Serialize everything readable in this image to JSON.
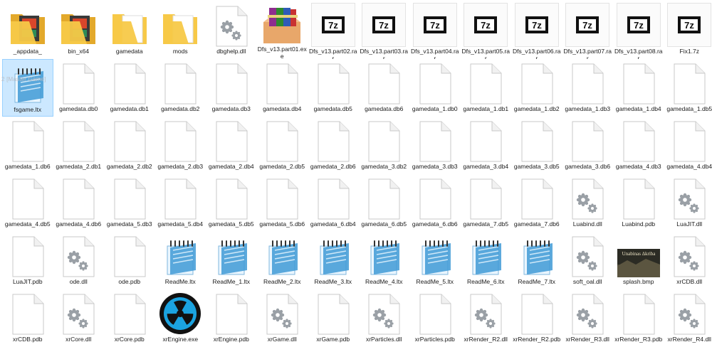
{
  "files": [
    {
      "name": "_appdata_",
      "icon": "folder-dark-icon"
    },
    {
      "name": "bin_x64",
      "icon": "folder-dark-icon"
    },
    {
      "name": "gamedata",
      "icon": "folder-icon"
    },
    {
      "name": "mods",
      "icon": "folder-icon"
    },
    {
      "name": "dbghelp.dll",
      "icon": "gear-file-icon"
    },
    {
      "name": "Dfs_v13.part01.exe",
      "icon": "winrar-sfx-icon"
    },
    {
      "name": "Dfs_v13.part02.rar",
      "icon": "7z-archive-icon"
    },
    {
      "name": "Dfs_v13.part03.rar",
      "icon": "7z-archive-icon"
    },
    {
      "name": "Dfs_v13.part04.rar",
      "icon": "7z-archive-icon"
    },
    {
      "name": "Dfs_v13.part05.rar",
      "icon": "7z-archive-icon"
    },
    {
      "name": "Dfs_v13.part06.rar",
      "icon": "7z-archive-icon"
    },
    {
      "name": "Dfs_v13.part07.rar",
      "icon": "7z-archive-icon"
    },
    {
      "name": "Dfs_v13.part08.rar",
      "icon": "7z-archive-icon"
    },
    {
      "name": "Fix1.7z",
      "icon": "7z-archive-icon"
    },
    {
      "name": "fsgame.ltx",
      "icon": "notepad-icon"
    },
    {
      "name": "gamedata.db0",
      "icon": "blank-file-icon"
    },
    {
      "name": "gamedata.db1",
      "icon": "blank-file-icon"
    },
    {
      "name": "gamedata.db2",
      "icon": "blank-file-icon"
    },
    {
      "name": "gamedata.db3",
      "icon": "blank-file-icon"
    },
    {
      "name": "gamedata.db4",
      "icon": "blank-file-icon"
    },
    {
      "name": "gamedata.db5",
      "icon": "blank-file-icon"
    },
    {
      "name": "gamedata.db6",
      "icon": "blank-file-icon"
    },
    {
      "name": "gamedata_1.db0",
      "icon": "blank-file-icon"
    },
    {
      "name": "gamedata_1.db1",
      "icon": "blank-file-icon"
    },
    {
      "name": "gamedata_1.db2",
      "icon": "blank-file-icon"
    },
    {
      "name": "gamedata_1.db3",
      "icon": "blank-file-icon"
    },
    {
      "name": "gamedata_1.db4",
      "icon": "blank-file-icon"
    },
    {
      "name": "gamedata_1.db5",
      "icon": "blank-file-icon"
    },
    {
      "name": "gamedata_1.db6",
      "icon": "blank-file-icon"
    },
    {
      "name": "gamedata_2.db1",
      "icon": "blank-file-icon"
    },
    {
      "name": "gamedata_2.db2",
      "icon": "blank-file-icon"
    },
    {
      "name": "gamedata_2.db3",
      "icon": "blank-file-icon"
    },
    {
      "name": "gamedata_2.db4",
      "icon": "blank-file-icon"
    },
    {
      "name": "gamedata_2.db5",
      "icon": "blank-file-icon"
    },
    {
      "name": "gamedata_2.db6",
      "icon": "blank-file-icon"
    },
    {
      "name": "gamedata_3.db2",
      "icon": "blank-file-icon"
    },
    {
      "name": "gamedata_3.db3",
      "icon": "blank-file-icon"
    },
    {
      "name": "gamedata_3.db4",
      "icon": "blank-file-icon"
    },
    {
      "name": "gamedata_3.db5",
      "icon": "blank-file-icon"
    },
    {
      "name": "gamedata_3.db6",
      "icon": "blank-file-icon"
    },
    {
      "name": "gamedata_4.db3",
      "icon": "blank-file-icon"
    },
    {
      "name": "gamedata_4.db4",
      "icon": "blank-file-icon"
    },
    {
      "name": "gamedata_4.db5",
      "icon": "blank-file-icon"
    },
    {
      "name": "gamedata_4.db6",
      "icon": "blank-file-icon"
    },
    {
      "name": "gamedata_5.db3",
      "icon": "blank-file-icon"
    },
    {
      "name": "gamedata_5.db4",
      "icon": "blank-file-icon"
    },
    {
      "name": "gamedata_5.db5",
      "icon": "blank-file-icon"
    },
    {
      "name": "gamedata_5.db6",
      "icon": "blank-file-icon"
    },
    {
      "name": "gamedata_6.db4",
      "icon": "blank-file-icon"
    },
    {
      "name": "gamedata_6.db5",
      "icon": "blank-file-icon"
    },
    {
      "name": "gamedata_6.db6",
      "icon": "blank-file-icon"
    },
    {
      "name": "gamedata_7.db5",
      "icon": "blank-file-icon"
    },
    {
      "name": "gamedata_7.db6",
      "icon": "blank-file-icon"
    },
    {
      "name": "Luabind.dll",
      "icon": "gear-file-icon"
    },
    {
      "name": "Luabind.pdb",
      "icon": "blank-file-icon"
    },
    {
      "name": "LuaJIT.dll",
      "icon": "gear-file-icon"
    },
    {
      "name": "LuaJIT.pdb",
      "icon": "blank-file-icon"
    },
    {
      "name": "ode.dll",
      "icon": "gear-file-icon"
    },
    {
      "name": "ode.pdb",
      "icon": "blank-file-icon"
    },
    {
      "name": "ReadMe.ltx",
      "icon": "notepad-icon"
    },
    {
      "name": "ReadMe_1.ltx",
      "icon": "notepad-icon"
    },
    {
      "name": "ReadMe_2.ltx",
      "icon": "notepad-icon"
    },
    {
      "name": "ReadMe_3.ltx",
      "icon": "notepad-icon"
    },
    {
      "name": "ReadMe_4.ltx",
      "icon": "notepad-icon"
    },
    {
      "name": "ReadMe_5.ltx",
      "icon": "notepad-icon"
    },
    {
      "name": "ReadMe_6.ltx",
      "icon": "notepad-icon"
    },
    {
      "name": "ReadMe_7.ltx",
      "icon": "notepad-icon"
    },
    {
      "name": "soft_oal.dll",
      "icon": "gear-file-icon"
    },
    {
      "name": "splash.bmp",
      "icon": "image-thumbnail-icon"
    },
    {
      "name": "xrCDB.dll",
      "icon": "gear-file-icon"
    },
    {
      "name": "xrCDB.pdb",
      "icon": "blank-file-icon"
    },
    {
      "name": "xrCore.dll",
      "icon": "gear-file-icon"
    },
    {
      "name": "xrCore.pdb",
      "icon": "blank-file-icon"
    },
    {
      "name": "xrEngine.exe",
      "icon": "radiation-icon"
    },
    {
      "name": "xrEngine.pdb",
      "icon": "blank-file-icon"
    },
    {
      "name": "xrGame.dll",
      "icon": "gear-file-icon"
    },
    {
      "name": "xrGame.pdb",
      "icon": "blank-file-icon"
    },
    {
      "name": "xrParticles.dll",
      "icon": "gear-file-icon"
    },
    {
      "name": "xrParticles.pdb",
      "icon": "blank-file-icon"
    },
    {
      "name": "xrRender_R2.dll",
      "icon": "gear-file-icon"
    },
    {
      "name": "xrRender_R2.pdb",
      "icon": "blank-file-icon"
    },
    {
      "name": "xrRender_R3.dll",
      "icon": "gear-file-icon"
    },
    {
      "name": "xrRender_R3.pdb",
      "icon": "blank-file-icon"
    },
    {
      "name": "xrRender_R4.dll",
      "icon": "gear-file-icon"
    }
  ],
  "selected_index": 14,
  "overlay_text": "2 [Master Game]",
  "splash_title": "Unabinas ∆kriba",
  "colors": {
    "selection": "#cce8ff",
    "folder": "#f7c948",
    "folder_dark": "#e3a92b",
    "gear": "#9aa0a6",
    "notepad_blue": "#3f9ad6",
    "radiation_yellow": "#1ba3e0",
    "radiation_bg": "#111111"
  }
}
